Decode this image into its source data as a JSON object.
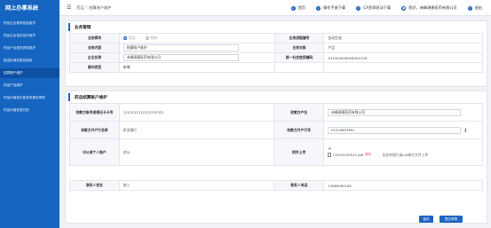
{
  "header": {
    "logo": "网上办事系统",
    "breadcrumb_home": "药品",
    "breadcrumb_current": "结算账户维护",
    "nav": [
      {
        "label": "首页",
        "icon": "home-icon"
      },
      {
        "label": "操作手册下载",
        "icon": "download-icon"
      },
      {
        "label": "CA签章驱动下载",
        "icon": "ca-icon"
      },
      {
        "label": "您好，赤峰源康医药有限公司",
        "icon": "user-icon"
      },
      {
        "label": "退出",
        "icon": "power-icon"
      }
    ]
  },
  "sidebar": {
    "items": [
      {
        "label": "药品企业基本信息维护",
        "active": false
      },
      {
        "label": "药品企业相关证件维护",
        "active": false
      },
      {
        "label": "药品产品相关资质维护",
        "active": false
      },
      {
        "label": "配送区域变更及授权",
        "active": false
      },
      {
        "label": "结算账户维护",
        "active": true
      },
      {
        "label": "药品产品维护",
        "active": false
      },
      {
        "label": "药品价格变化信息采集及审核",
        "active": false
      },
      {
        "label": "药品价格信息归档",
        "active": false
      }
    ]
  },
  "business": {
    "title": "业务管理",
    "biz_type_label": "业务模块",
    "biz_type_options": [
      "药品",
      "耗材"
    ],
    "biz_no_label": "业务流程编号",
    "biz_no_value": "自动生成",
    "biz_content_label": "业务内容",
    "biz_content_value": "结算账户维护",
    "biz_object_label": "业务对象",
    "biz_object_value": "产品",
    "company_label": "企业名称",
    "company_value": "赤峰源康医药有限公司",
    "credit_label": "统一社会信用编码",
    "credit_value": "91150402692855427D",
    "op_type_label": "操作类型",
    "op_type_value": "新增"
  },
  "account": {
    "title": "药品结算账户维护",
    "receiver_account_label": "收款方账号或借记卡卡号",
    "receiver_account_value": "1212121212123232321",
    "receiver_name_label": "收款方户名",
    "receiver_name_value": "赤峰源康医药有限公司",
    "bank_label": "收款方开户行名称",
    "bank_value": "农业银行",
    "bank_no_label": "收款方开户行号",
    "bank_no_value": "01234657691",
    "biz_kind_label": "对公或个人账户",
    "biz_kind_value": "对公",
    "attachment_label": "附件上传",
    "attachment_file": "CCF20245511.pdf",
    "attachment_delete": "删除",
    "attachment_hint": "仅支持图片或pdf格式文件上传",
    "contact_label": "联系人姓名",
    "contact_value": "张三",
    "phone_label": "联系人电话",
    "phone_value": "13069260182"
  },
  "actions": {
    "save": "保存",
    "submit": "提交审核"
  }
}
